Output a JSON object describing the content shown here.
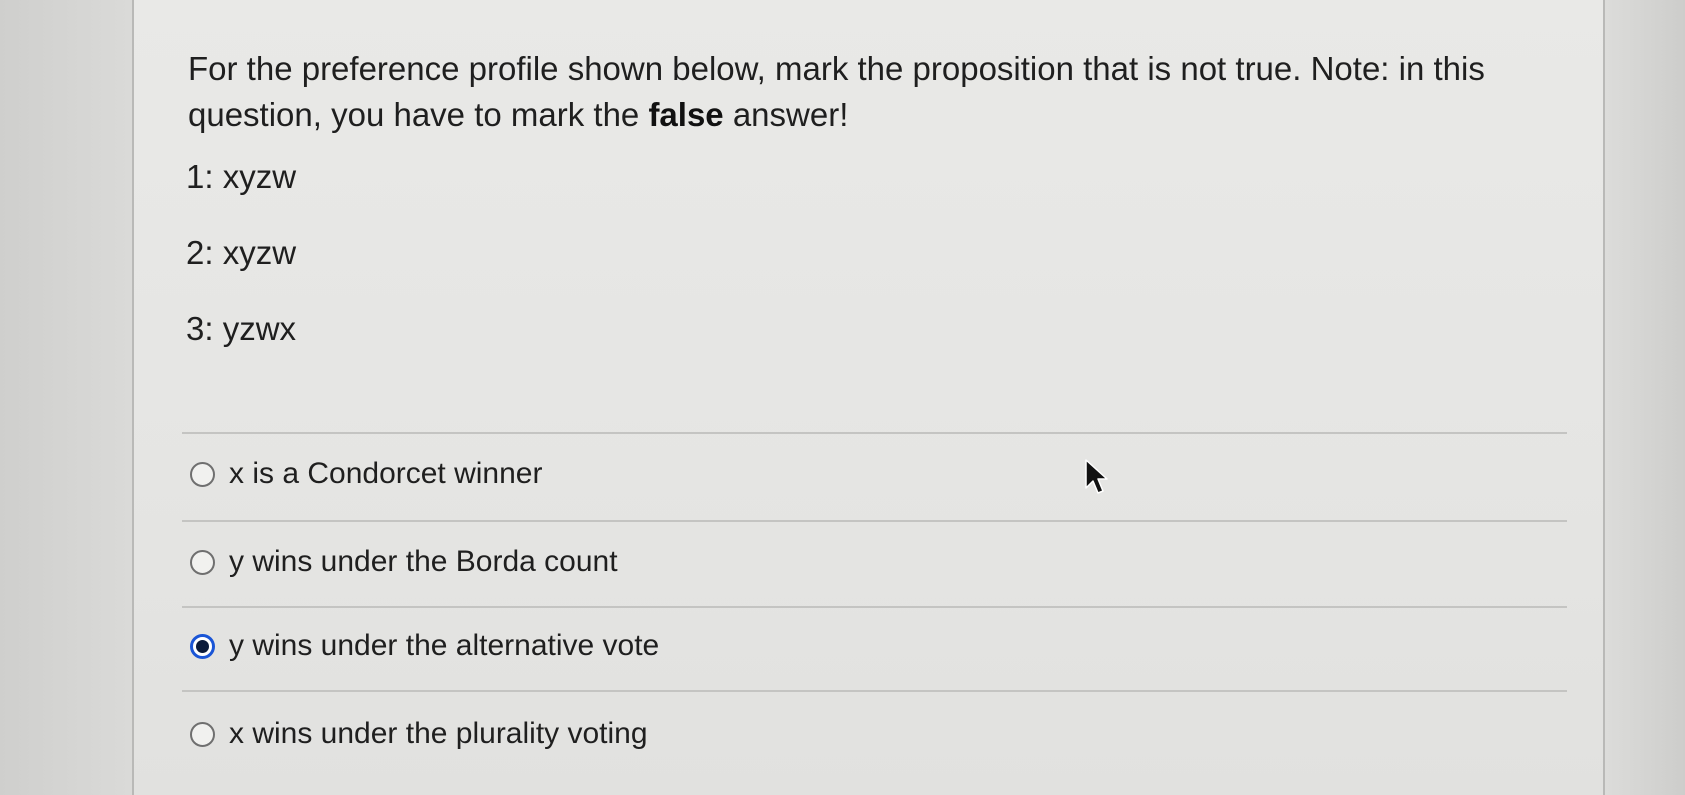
{
  "question": {
    "prompt_before": "For the preference profile shown below, mark the proposition that is not true.  Note: in this question, you have to mark the ",
    "prompt_bold": "false",
    "prompt_after": " answer!",
    "profile": [
      "1: xyzw",
      "2: xyzw",
      "3: yzwx"
    ]
  },
  "options": [
    {
      "label": "x is a Condorcet winner",
      "checked": false
    },
    {
      "label": "y wins under the Borda count",
      "checked": false
    },
    {
      "label": "y wins under the alternative vote",
      "checked": true
    },
    {
      "label": "x wins under the plurality voting",
      "checked": false
    }
  ],
  "colors": {
    "selected_ring": "#1a55d6",
    "text": "#1f1f1f",
    "card_background": "#e7e7e5"
  },
  "icons": {
    "cursor": "mouse-pointer-icon",
    "radio": "radio-circle"
  }
}
